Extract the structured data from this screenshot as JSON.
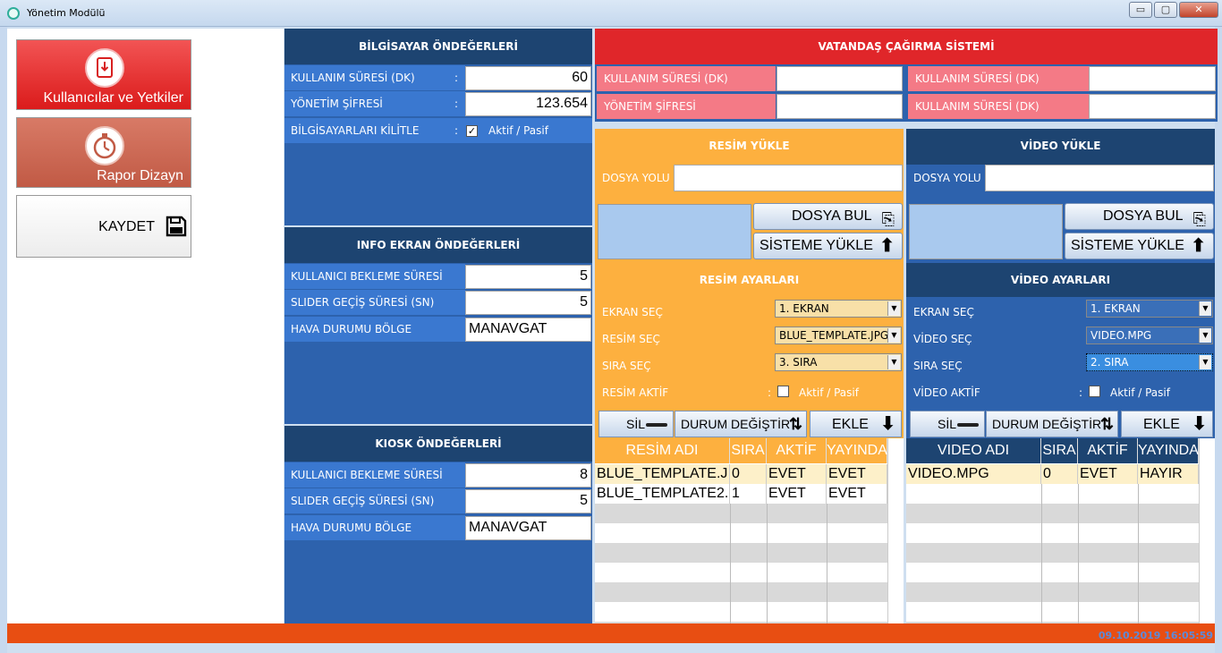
{
  "window": {
    "title": "Yönetim Modülü",
    "minimize": "▭",
    "maximize": "▢",
    "close": "✕"
  },
  "left": {
    "users_btn": "Kullanıcılar ve Yetkiler",
    "report_btn": "Rapor Dizayn",
    "save_btn": "KAYDET"
  },
  "pc": {
    "header": "BİLGİSAYAR ÖNDEĞERLERİ",
    "rows": [
      {
        "label": "KULLANIM SÜRESİ (DK)",
        "value": "60"
      },
      {
        "label": "YÖNETİM ŞİFRESİ",
        "value": "123.654"
      },
      {
        "label": "BİLGİSAYARLARI KİLİTLE",
        "value": "Aktif / Pasif"
      }
    ]
  },
  "info": {
    "header": "INFO EKRAN ÖNDEĞERLERİ",
    "rows": [
      {
        "label": "KULLANICI BEKLEME SÜRESİ (DK)",
        "value": "5"
      },
      {
        "label": "SLIDER GEÇİŞ SÜRESİ (SN)",
        "value": "5"
      },
      {
        "label": "HAVA DURUMU BÖLGE",
        "value": "MANAVGAT"
      }
    ]
  },
  "kiosk": {
    "header": "KIOSK ÖNDEĞERLERİ",
    "rows": [
      {
        "label": "KULLANICI BEKLEME SÜRESİ (SN)",
        "value": "8"
      },
      {
        "label": "SLIDER GEÇİŞ SÜRESİ (SN)",
        "value": "5"
      },
      {
        "label": "HAVA DURUMU BÖLGE",
        "value": "MANAVGAT"
      }
    ]
  },
  "vcs": {
    "header": "VATANDAŞ ÇAĞIRMA SİSTEMİ",
    "l1": "KULLANIM SÜRESİ (DK)",
    "l2": "YÖNETİM ŞİFRESİ",
    "r1": "KULLANIM SÜRESİ (DK)",
    "r2": "KULLANIM SÜRESİ (DK)",
    "colon": ":"
  },
  "img": {
    "upload_header": "RESİM YÜKLE",
    "path_label": "DOSYA YOLU",
    "find_btn": "DOSYA BUL",
    "upload_btn": "SİSTEME YÜKLE",
    "settings_header": "RESİM AYARLARI",
    "screen_label": "EKRAN SEÇ",
    "screen_value": "1. EKRAN",
    "item_label": "RESİM SEÇ",
    "item_value": "BLUE_TEMPLATE.JPG",
    "order_label": "SIRA SEÇ",
    "order_value": "3. SIRA",
    "active_label": "RESİM AKTİF",
    "active_text": "Aktif / Pasif",
    "del_btn": "SİL",
    "status_btn": "DURUM DEĞİŞTİR",
    "add_btn": "EKLE",
    "cols": [
      "RESİM ADI",
      "SIRA",
      "AKTİF",
      "YAYINDA"
    ],
    "rows": [
      [
        "BLUE_TEMPLATE.J",
        "0",
        "EVET",
        "EVET"
      ],
      [
        "BLUE_TEMPLATE2.",
        "1",
        "EVET",
        "EVET"
      ]
    ]
  },
  "vid": {
    "upload_header": "VİDEO YÜKLE",
    "path_label": "DOSYA YOLU",
    "find_btn": "DOSYA BUL",
    "upload_btn": "SİSTEME YÜKLE",
    "settings_header": "VİDEO AYARLARI",
    "screen_label": "EKRAN SEÇ",
    "screen_value": "1. EKRAN",
    "item_label": "VİDEO SEÇ",
    "item_value": "VIDEO.MPG",
    "order_label": "SIRA SEÇ",
    "order_value": "2. SIRA",
    "active_label": "VİDEO AKTİF",
    "active_text": "Aktif / Pasif",
    "del_btn": "SİL",
    "status_btn": "DURUM DEĞİŞTİR",
    "add_btn": "EKLE",
    "cols": [
      "VIDEO ADI",
      "SIRA",
      "AKTİF",
      "YAYINDA"
    ],
    "rows": [
      [
        "VIDEO.MPG",
        "0",
        "EVET",
        "HAYIR"
      ]
    ]
  },
  "status": {
    "datetime": "09.10.2019 16:05:59"
  },
  "colors": {
    "red": "#e0262a",
    "orange": "#fdb03f",
    "blue": "#2d62ad",
    "navy": "#1d4471",
    "status": "#e84e12"
  }
}
